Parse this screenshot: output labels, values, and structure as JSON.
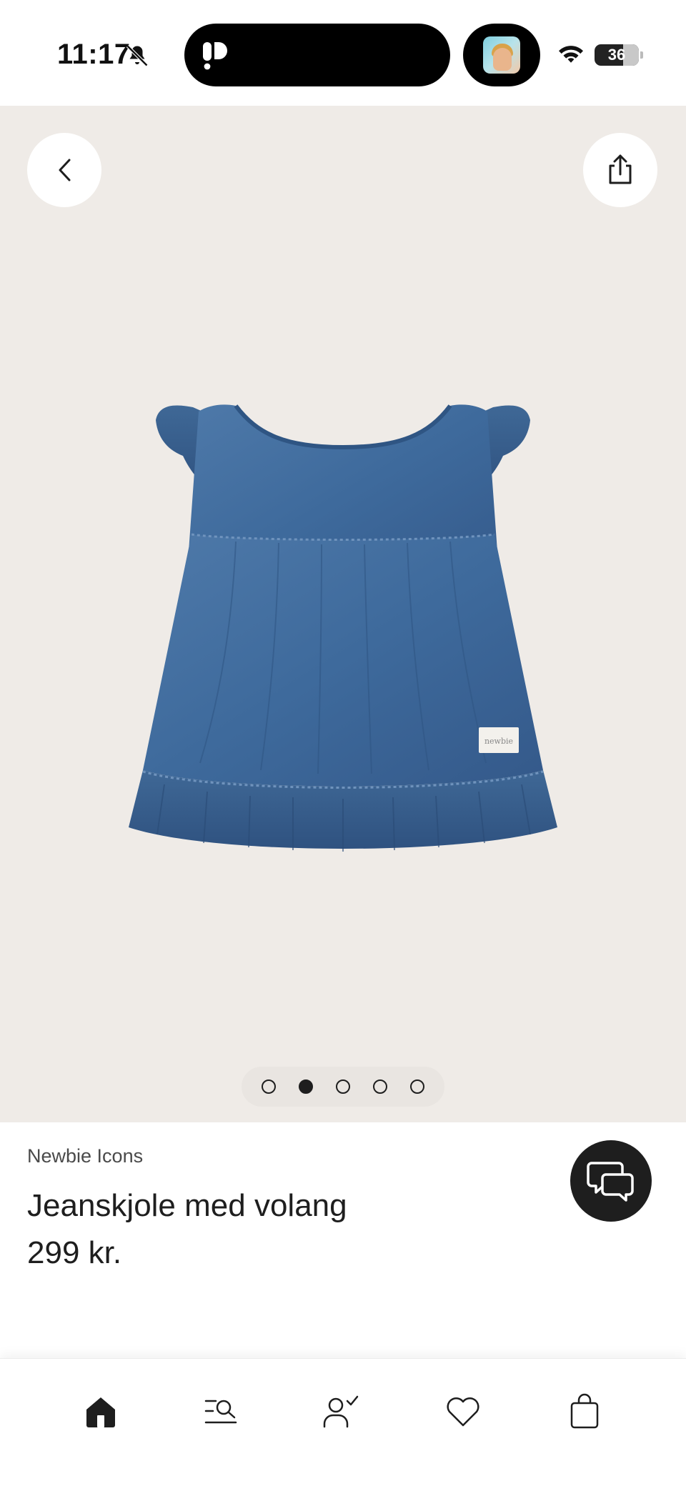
{
  "status_bar": {
    "time": "11:17",
    "battery_level": "36",
    "battery_fraction": 0.36,
    "icons": [
      "bell-off-icon",
      "wifi-icon",
      "battery-icon"
    ]
  },
  "hero": {
    "background_color": "#efebe7",
    "image_subject": "denim-dress",
    "label_on_garment": "newbie",
    "carousel": {
      "total": 5,
      "active_index": 1
    },
    "buttons": [
      "back-icon",
      "share-icon"
    ]
  },
  "product": {
    "brand": "Newbie Icons",
    "title": "Jeanskjole med volang",
    "price": "299 kr."
  },
  "chat": {
    "icon": "chat-icon",
    "color": "#1e1e1e"
  },
  "tabbar": {
    "tabs": [
      {
        "icon": "home-icon",
        "active": true
      },
      {
        "icon": "search-list-icon",
        "active": false
      },
      {
        "icon": "account-icon",
        "active": false
      },
      {
        "icon": "heart-icon",
        "active": false
      },
      {
        "icon": "bag-icon",
        "active": false
      }
    ]
  }
}
